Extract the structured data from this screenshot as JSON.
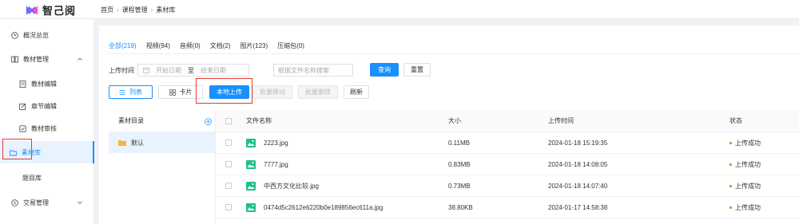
{
  "app": {
    "name": "智己阅",
    "brand_color": "#1890ff"
  },
  "breadcrumb": [
    "首页",
    "课程管理",
    "素材库"
  ],
  "sidebar": {
    "items": [
      {
        "label": "概况总览",
        "icon": "clock-icon"
      },
      {
        "label": "教材管理",
        "icon": "book-icon",
        "expanded": true
      },
      {
        "label": "教材编辑",
        "icon": "document-icon"
      },
      {
        "label": "章节编辑",
        "icon": "edit-icon"
      },
      {
        "label": "教材审核",
        "icon": "check-icon"
      },
      {
        "label": "素材库",
        "icon": "folder-icon",
        "active": true
      },
      {
        "label": "题目库",
        "icon": ""
      },
      {
        "label": "交易管理",
        "icon": "transaction-icon",
        "expanded": false
      }
    ]
  },
  "tabs": [
    {
      "label": "全部(219)",
      "active": true
    },
    {
      "label": "视频(94)"
    },
    {
      "label": "音频(0)"
    },
    {
      "label": "文档(2)"
    },
    {
      "label": "图片(123)"
    },
    {
      "label": "压缩包(0)"
    }
  ],
  "filter": {
    "upload_time_label": "上传时间",
    "start_placeholder": "开始日期",
    "to_label": "至",
    "end_placeholder": "结束日期",
    "search_placeholder": "根据文件名称搜索",
    "query_button": "查询",
    "reset_button": "重置"
  },
  "toolbar": {
    "list_view": "列表",
    "card_view": "卡片",
    "local_upload": "本地上传",
    "batch_move": "批量移动",
    "batch_delete": "批量删除",
    "refresh": "刷新"
  },
  "folders": {
    "title": "素材目录",
    "items": [
      {
        "label": "默认"
      }
    ]
  },
  "table": {
    "columns": [
      "文件名称",
      "大小",
      "上传时间",
      "状态"
    ],
    "rows": [
      {
        "name": "2223.jpg",
        "size": "0.11MB",
        "time": "2024-01-18 15:19:35",
        "status": "上传成功"
      },
      {
        "name": "7777.jpg",
        "size": "0.83MB",
        "time": "2024-01-18 14:08:05",
        "status": "上传成功"
      },
      {
        "name": "中西方文化比较.jpg",
        "size": "0.73MB",
        "time": "2024-01-18 14:07:40",
        "status": "上传成功"
      },
      {
        "name": "0474d5c2612e6220b0e189856ec611a.jpg",
        "size": "38.80KB",
        "time": "2024-01-17 14:58:38",
        "status": "上传成功"
      }
    ]
  }
}
